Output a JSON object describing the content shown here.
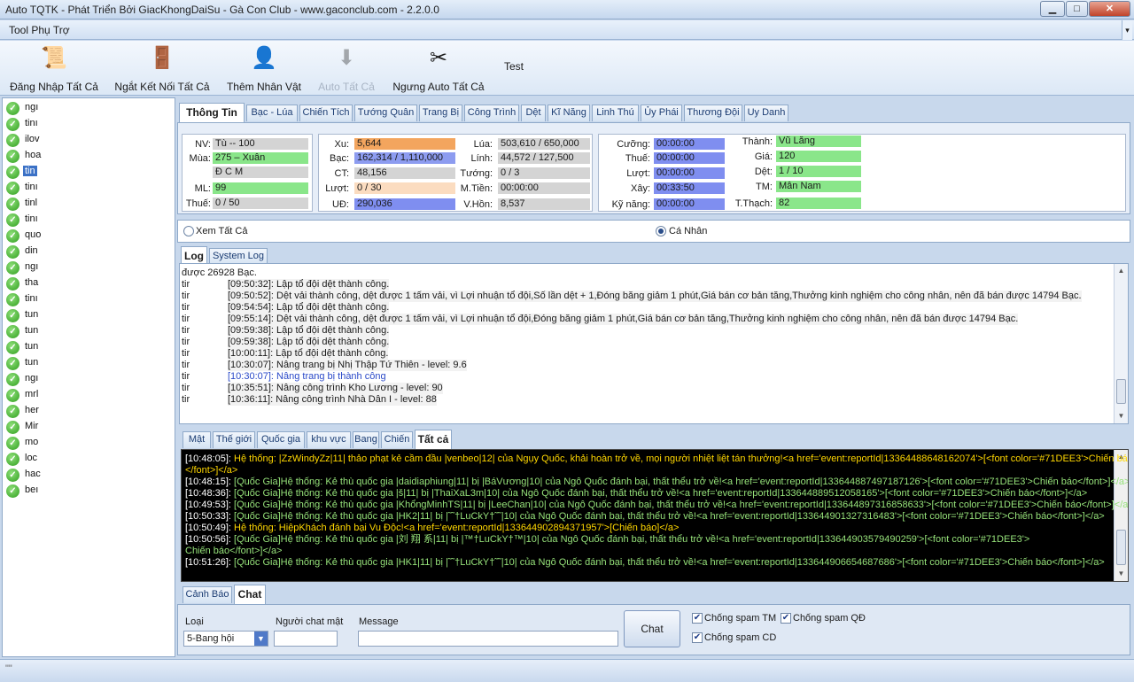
{
  "window": {
    "title": "Auto TQTK - Phát Triển Bởi GiacKhongDaiSu - Gà Con Club - www.gaconclub.com - 2.2.0.0",
    "min": "▁",
    "max": "□",
    "close": "✕"
  },
  "menu": {
    "tool": "Tool Phụ Trợ",
    "arrow": "▾"
  },
  "toolbar": [
    {
      "name": "login-all-button",
      "icon": "scroll-key-icon",
      "glyph": "📜",
      "label": "Đăng Nhập Tất Cả",
      "enabled": true
    },
    {
      "name": "disconnect-all-button",
      "icon": "exit-door-icon",
      "glyph": "🚪",
      "label": "Ngắt Kết Nối Tất Cả",
      "enabled": true
    },
    {
      "name": "add-character-button",
      "icon": "person-card-icon",
      "glyph": "👤",
      "label": "Thêm Nhân Vật",
      "enabled": true
    },
    {
      "name": "auto-all-button",
      "icon": "download-circle-icon",
      "glyph": "⬇",
      "label": "Auto Tất Cả",
      "enabled": false
    },
    {
      "name": "stop-auto-all-button",
      "icon": "scissors-icon",
      "glyph": "✂",
      "label": "Ngưng Auto Tất Cả",
      "enabled": true
    },
    {
      "name": "test-button",
      "icon": "",
      "glyph": "",
      "label": "Test",
      "enabled": true
    }
  ],
  "accounts": [
    "ngı",
    "tinı",
    "ilov",
    "hoa",
    "tin",
    "tinı",
    "tinl",
    "tinı",
    "quo",
    "din",
    "ngı",
    "tha",
    "tinı",
    "tun",
    "tun",
    "tun",
    "tun",
    "ngı",
    "mrl",
    "her",
    "Mir",
    "mo",
    "loc",
    "hac",
    "beı"
  ],
  "selected_account": 4,
  "main_tabs": [
    "Thông Tin",
    "Bạc - Lúa",
    "Chiến Tích",
    "Tướng Quân",
    "Trang Bị",
    "Công Trình",
    "Dệt",
    "Kĩ Năng",
    "Linh Thú",
    "Ủy Phái",
    "Thương Đội",
    "Uy Danh"
  ],
  "info": {
    "g1": {
      "nv_label": "NV:",
      "nv_value": "Tù             -- 100",
      "mua_label": "Mùa:",
      "mua_value": "275 – Xuân",
      "dcm": "Đ     C     M",
      "ml_label": "ML:",
      "ml_value": "99",
      "thue_label": "Thuế:",
      "thue_value": "0 / 50"
    },
    "g2": {
      "xu_label": "Xu:",
      "xu": "5,644",
      "bac_label": "Bạc:",
      "bac": "162,314 / 1,110,000",
      "ct_label": "CT:",
      "ct": "48,156",
      "luot_label": "Lượt:",
      "luot": "0 / 30",
      "ud_label": "UĐ:",
      "ud": "290,036",
      "lua_label": "Lúa:",
      "lua": "503,610 / 650,000",
      "linh_label": "Lính:",
      "linh": "44,572 / 127,500",
      "tuong_label": "Tướng:",
      "tuong": "0 / 3",
      "mtien_label": "M.Tiền:",
      "mtien": "00:00:00",
      "vhon_label": "V.Hồn:",
      "vhon": "8,537"
    },
    "g3": {
      "cuong_label": "Cưỡng:",
      "cuong": "00:00:00",
      "thue_label": "Thuế:",
      "thue": "00:00:00",
      "luot_label": "Lượt:",
      "luot": "00:00:00",
      "xay_label": "Xây:",
      "xay": "00:33:50",
      "kynang_label": "Kỹ năng:",
      "kynang": "00:00:00",
      "thanh_label": "Thành:",
      "thanh": "Vũ Lăng",
      "gia_label": "Giá:",
      "gia": "120",
      "det_label": "Dệt:",
      "det": "1 / 10",
      "tm_label": "TM:",
      "tm": "Mân Nam",
      "tthach_label": "T.Thạch:",
      "tthach": "82"
    }
  },
  "view": {
    "all": "Xem Tất Cả",
    "personal": "Cá Nhân",
    "selected": "personal"
  },
  "log_tabs": [
    "Log",
    "System Log"
  ],
  "log": [
    {
      "p": "",
      "t": "được 26928 Bạc.",
      "first": true
    },
    {
      "p": "tir",
      "t": "[09:50:32]: Lập tổ đội dệt thành công."
    },
    {
      "p": "tir",
      "t": "[09:50:52]: Dệt vải thành công, dệt được 1 tấm vải, vì Lợi nhuận tổ đội,Số lần dệt + 1,Đóng băng giảm 1 phút,Giá bán cơ bản tăng,Thưởng kinh nghiệm cho công nhân, nên đã bán được 14794 Bạc."
    },
    {
      "p": "tir",
      "t": "[09:54:54]: Lập tổ đội dệt thành công."
    },
    {
      "p": "tir",
      "t": "[09:55:14]: Dệt vải thành công, dệt được 1 tấm vải, vì Lợi nhuận tổ đội,Đóng băng giảm 1 phút,Giá bán cơ bản tăng,Thưởng kinh nghiệm cho công nhân, nên đã bán được 14794 Bạc."
    },
    {
      "p": "tir",
      "t": "[09:59:38]: Lập tổ đội dệt thành công."
    },
    {
      "p": "tir",
      "t": "[09:59:38]: Lập tổ đội dệt thành công."
    },
    {
      "p": "tir",
      "t": "[10:00:11]: Lập tổ đội dệt thành công."
    },
    {
      "p": "tir",
      "t": "[10:30:07]: Nâng trang bị Nhị Thập Tứ Thiên - level: 9.6"
    },
    {
      "p": "tir",
      "t": "[10:30:07]: Nâng trang bị thành công",
      "blue": true
    },
    {
      "p": "tir",
      "t": "[10:35:51]: Nâng công trình Kho Lương - level: 90"
    },
    {
      "p": "tir",
      "t": "[10:36:11]: Nâng công trình Nhà Dân I - level: 88"
    }
  ],
  "chat_tabs": [
    "Mật",
    "Thế giới",
    "Quốc gia",
    "khu vực",
    "Bang",
    "Chiến",
    "Tất cả"
  ],
  "chat_log": [
    {
      "c": "y",
      "ts": "[10:48:05]: ",
      "t": "Hệ thống: |ZzWindyZz|11| thảo phạt kẻ cầm đầu |venbeo|12| của Ngụy Quốc, khải hoàn trở về, mọi người nhiệt liệt tán thưởng!<a href='event:reportId|13364488648162074'>[<font color='#71DEE3'>Chiến báo"
    },
    {
      "c": "y",
      "ts": "",
      "t": "</font>]</a>"
    },
    {
      "c": "g",
      "ts": "[10:48:15]: ",
      "t": "[Quốc Gia]Hệ thống: Kẻ thù quốc gia |daidiaphiung|11| bị |BáVương|10| của Ngô Quốc đánh bại, thất thểu trở về!<a href='event:reportId|133644887497187126'>[<font color='#71DEE3'>Chiến báo</font>]</a>"
    },
    {
      "c": "g",
      "ts": "[10:48:36]: ",
      "t": "[Quốc Gia]Hệ thống: Kẻ thù quốc gia |š|11| bị |ThaiXaL3m|10| của Ngô Quốc đánh bại, thất thểu trở về!<a href='event:reportId|133644889512058165'>[<font color='#71DEE3'>Chiến báo</font>]</a>"
    },
    {
      "c": "g",
      "ts": "[10:49:53]: ",
      "t": "[Quốc Gia]Hệ thống: Kẻ thù quốc gia |KhổngMinhTS|11| bị |LeeChan|10| của Ngô Quốc đánh bại, thất thểu trở về!<a href='event:reportId|133644897316858633'>[<font color='#71DEE3'>Chiến báo</font>]</a>"
    },
    {
      "c": "g",
      "ts": "[10:50:33]: ",
      "t": "[Quốc Gia]Hệ thống: Kẻ thù quốc gia |HK2|11| bị |˜˜†LuCkY†˜˜|10| của Ngô Quốc đánh bại, thất thểu trở về!<a href='event:reportId|133644901327316483'>[<font color='#71DEE3'>Chiến báo</font>]</a>"
    },
    {
      "c": "y",
      "ts": "[10:50:49]: ",
      "t": "Hệ thống: HiệpKhách đánh bại  Vu Độc!<a href='event:reportId|133644902894371957'>[Chiến báo]</a>"
    },
    {
      "c": "g",
      "ts": "[10:50:56]: ",
      "t": "[Quốc Gia]Hệ thống: Kẻ thù quốc gia |刘 翔 系|11| bị |™†LuCkY†™|10| của Ngô Quốc đánh bại, thất thểu trở về!<a href='event:reportId|133644903579490259'>[<font color='#71DEE3'>"
    },
    {
      "c": "g",
      "ts": "",
      "t": "Chiến báo</font>]</a>"
    },
    {
      "c": "g",
      "ts": "[10:51:26]: ",
      "t": "[Quốc Gia]Hệ thống: Kẻ thù quốc gia |HK1|11| bị |˜˜†LuCkY†˜˜|10| của Ngô Quốc đánh bại, thất thểu trở về!<a href='event:reportId|133644906654687686'>[<font color='#71DEE3'>Chiến báo</font>]</a>"
    }
  ],
  "bottom_tabs": [
    "Cảnh Báo",
    "Chat"
  ],
  "chat": {
    "type_label": "Loại",
    "type_value": "5-Bang hội",
    "receiver_label": "Người chat mật",
    "receiver_value": "",
    "message_label": "Message",
    "message_value": "",
    "send": "Chat",
    "spam_tm": "Chống spam TM",
    "spam_qd": "Chống spam QĐ",
    "spam_cd": "Chống spam CD"
  },
  "status": {
    "text": "\"\""
  }
}
